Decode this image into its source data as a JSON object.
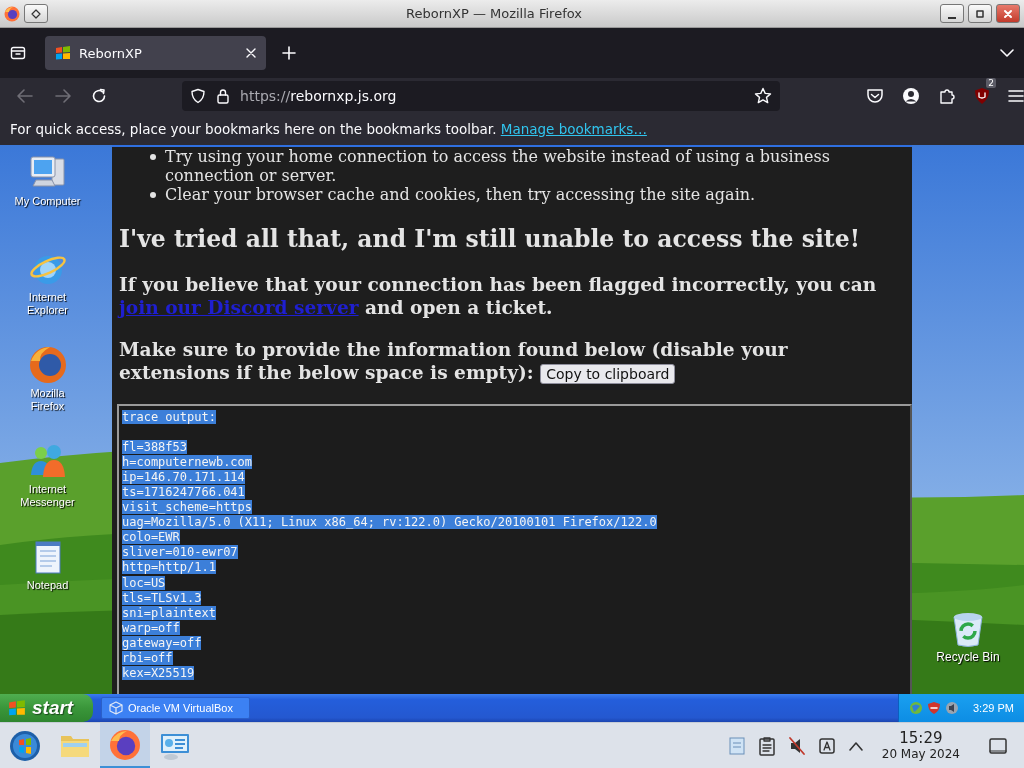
{
  "browser_window": {
    "title": "RebornXP — Mozilla Firefox"
  },
  "tabs": [
    {
      "label": "RebornXP",
      "selected": true
    }
  ],
  "address_bar": {
    "scheme": "https://",
    "host": "rebornxp.js.org"
  },
  "toolbar": {
    "extension_badge": "2"
  },
  "bookmarks_bar": {
    "message": "For quick access, place your bookmarks here on the bookmarks toolbar.",
    "link": "Manage bookmarks…"
  },
  "desktop": {
    "icons": [
      {
        "kind": "computer",
        "label": "My Computer"
      },
      {
        "kind": "globe",
        "label": "Internet Explorer"
      },
      {
        "kind": "firefox",
        "label": "Mozilla Firefox"
      },
      {
        "kind": "people",
        "label": "Internet Messenger"
      },
      {
        "kind": "notepad",
        "label": "Notepad"
      }
    ],
    "recycle_bin": {
      "label": "Recycle Bin"
    }
  },
  "page": {
    "bullets": [
      "Try using your home connection to access the website instead of using a business connection or server.",
      "Clear your browser cache and cookies, then try accessing the site again."
    ],
    "heading": "I've tried all that, and I'm still unable to access the site!",
    "paragraph": {
      "before": "If you believe that your connection has been flagged incorrectly, you can",
      "link": "join our Discord server",
      "after": "and open a ticket."
    },
    "instruction_lines": [
      "Make sure to provide the information found below (disable your",
      "extensions if the below space is empty):"
    ],
    "copy_button": "Copy to clipboard",
    "trace": {
      "text_selected": true,
      "header": "trace output:",
      "lines": [
        "fl=388f53",
        "h=computernewb.com",
        "ip=146.70.171.114",
        "ts=1716247766.041",
        "visit_scheme=https",
        "uag=Mozilla/5.0 (X11; Linux x86_64; rv:122.0) Gecko/20100101 Firefox/122.0",
        "colo=EWR",
        "sliver=010-ewr07",
        "http=http/1.1",
        "loc=US",
        "tls=TLSv1.3",
        "sni=plaintext",
        "warp=off",
        "gateway=off",
        "rbi=off",
        "kex=X25519"
      ]
    }
  },
  "xp_taskbar": {
    "start": "start",
    "tasks": [
      {
        "label": "Oracle VM VirtualBox",
        "selected": false
      }
    ],
    "clock": "3:29 PM"
  },
  "panel": {
    "apps": [
      {
        "kind": "orb",
        "selected": false
      },
      {
        "kind": "folder",
        "selected": false
      },
      {
        "kind": "firefox",
        "selected": true
      },
      {
        "kind": "monitor",
        "selected": false
      }
    ],
    "time": "15:29",
    "date": "20 May 2024"
  }
}
